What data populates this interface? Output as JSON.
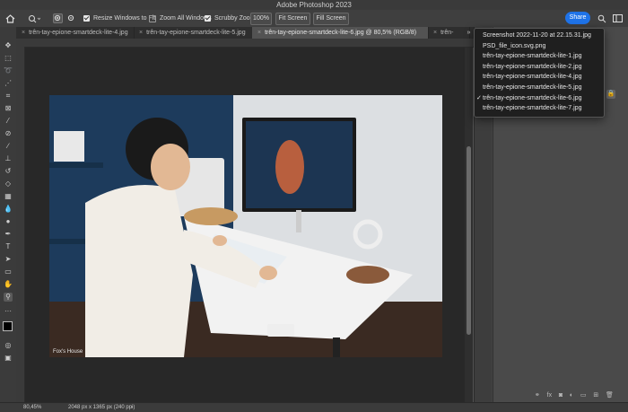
{
  "window": {
    "title": "Adobe Photoshop 2023"
  },
  "options_bar": {
    "resize_windows_label": "Resize Windows to Fit",
    "zoom_all_label": "Zoom All Windows",
    "scrubby_label": "Scrubby Zoom",
    "zoom_value": "100%",
    "fit_screen_label": "Fit Screen",
    "fill_screen_label": "Fill Screen",
    "share_label": "Share"
  },
  "tabs": [
    {
      "label": "trên-tay-epione-smartdeck-lite-4.jpg",
      "active": false
    },
    {
      "label": "trên-tay-epione-smartdeck-lite-5.jpg",
      "active": false
    },
    {
      "label": "trên-tay-epione-smartdeck-lite-6.jpg @ 80,5% (RGB/8)",
      "active": true
    },
    {
      "label": "trên-",
      "active": false
    }
  ],
  "window_menu": {
    "items": [
      {
        "label": "Screenshot 2022-11-20 at 22.15.31.jpg",
        "checked": false
      },
      {
        "label": "PSD_file_icon.svg.png",
        "checked": false
      },
      {
        "label": "trên-tay-epione-smartdeck-lite-1.jpg",
        "checked": false
      },
      {
        "label": "trên-tay-epione-smartdeck-lite-2.jpg",
        "checked": false
      },
      {
        "label": "trên-tay-epione-smartdeck-lite-4.jpg",
        "checked": false
      },
      {
        "label": "trên-tay-epione-smartdeck-lite-5.jpg",
        "checked": false
      },
      {
        "label": "trên-tay-epione-smartdeck-lite-6.jpg",
        "checked": true
      },
      {
        "label": "trên-tay-epione-smartdeck-lite-7.jpg",
        "checked": false
      }
    ]
  },
  "image": {
    "watermark": "Fox's House"
  },
  "status_bar": {
    "zoom": "80,45%",
    "doc_info": "2048 px x 1365 px (240 ppi)"
  },
  "colors": {
    "accent": "#1f73e8",
    "menu_bg": "#1f1f1f"
  }
}
